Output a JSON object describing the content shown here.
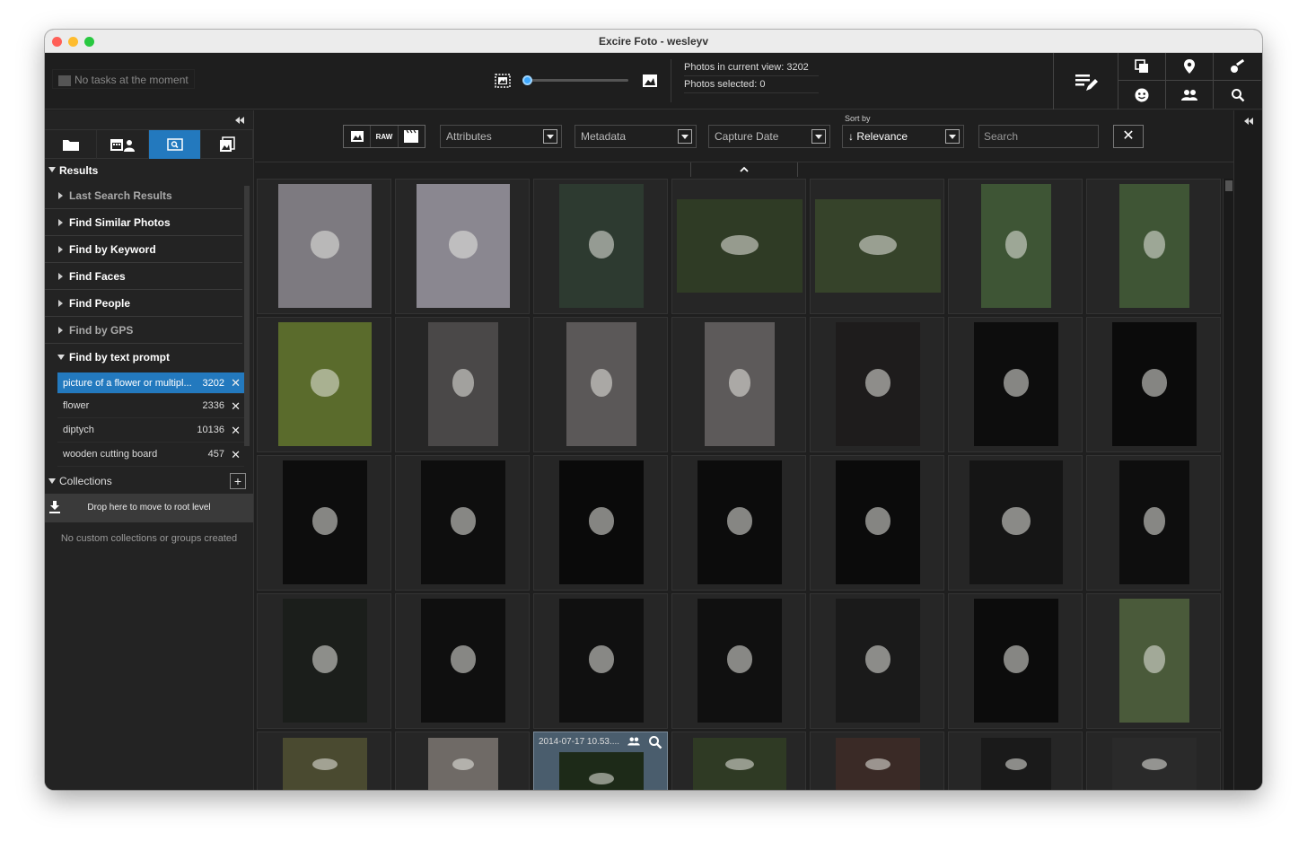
{
  "window": {
    "title": "Excire Foto - wesleyv"
  },
  "topbar": {
    "task_status": "No tasks at the moment",
    "zoom_level": 0.05,
    "photos_in_view": "Photos in current view: 3202",
    "photos_selected": "Photos selected: 0",
    "icons": [
      "edit-list-icon",
      "duplicates-icon",
      "location-pin-icon",
      "keyword-icon",
      "face-icon",
      "people-icon",
      "search-icon"
    ]
  },
  "sidebar": {
    "tabs": [
      "folder-icon",
      "calendar-people-icon",
      "search-tab-icon",
      "collections-icon"
    ],
    "results_label": "Results",
    "items": [
      {
        "label": "Last Search Results"
      },
      {
        "label": "Find Similar Photos"
      },
      {
        "label": "Find by Keyword"
      },
      {
        "label": "Find Faces"
      },
      {
        "label": "Find People"
      },
      {
        "label": "Find by GPS"
      },
      {
        "label": "Find by text prompt"
      }
    ],
    "queries": [
      {
        "text": "picture of a flower or multipl...",
        "count": "3202"
      },
      {
        "text": "flower",
        "count": "2336"
      },
      {
        "text": "diptych",
        "count": "10136"
      },
      {
        "text": "wooden cutting board",
        "count": "457"
      }
    ],
    "collections_label": "Collections",
    "drop_text": "Drop here to move to root level",
    "no_collections": "No custom collections or groups created"
  },
  "filterbar": {
    "raw_label": "RAW",
    "attributes": "Attributes",
    "metadata": "Metadata",
    "capture_date": "Capture Date",
    "sort_by_label": "Sort by",
    "sort_value": "Relevance",
    "search_placeholder": "Search"
  },
  "grid": {
    "hover_caption": "2014-07-17 10.53....",
    "colors": [
      "#7d7a80",
      "#8a8790",
      "#2d3a30",
      "#2f3b25",
      "#36432a",
      "#3e5535",
      "#3f5535",
      "#5a6b2c",
      "#4a4848",
      "#5b5858",
      "#5d5a5a",
      "#1e1c1c",
      "#0d0d0d",
      "#0b0b0b",
      "#0d0d0d",
      "#0e0e0e",
      "#0a0a0a",
      "#0c0c0c",
      "#0b0b0b",
      "#151515",
      "#0e0e0e",
      "#1b1e1b",
      "#0f0f0f",
      "#101010",
      "#101010",
      "#1a1a1a",
      "#0c0c0c",
      "#4a5a3a",
      "#4a4a30",
      "#6f6a66",
      "#1d2a18",
      "#2f3a24",
      "#3a2a26",
      "#1a1a1a",
      "#2a2a2a"
    ]
  }
}
